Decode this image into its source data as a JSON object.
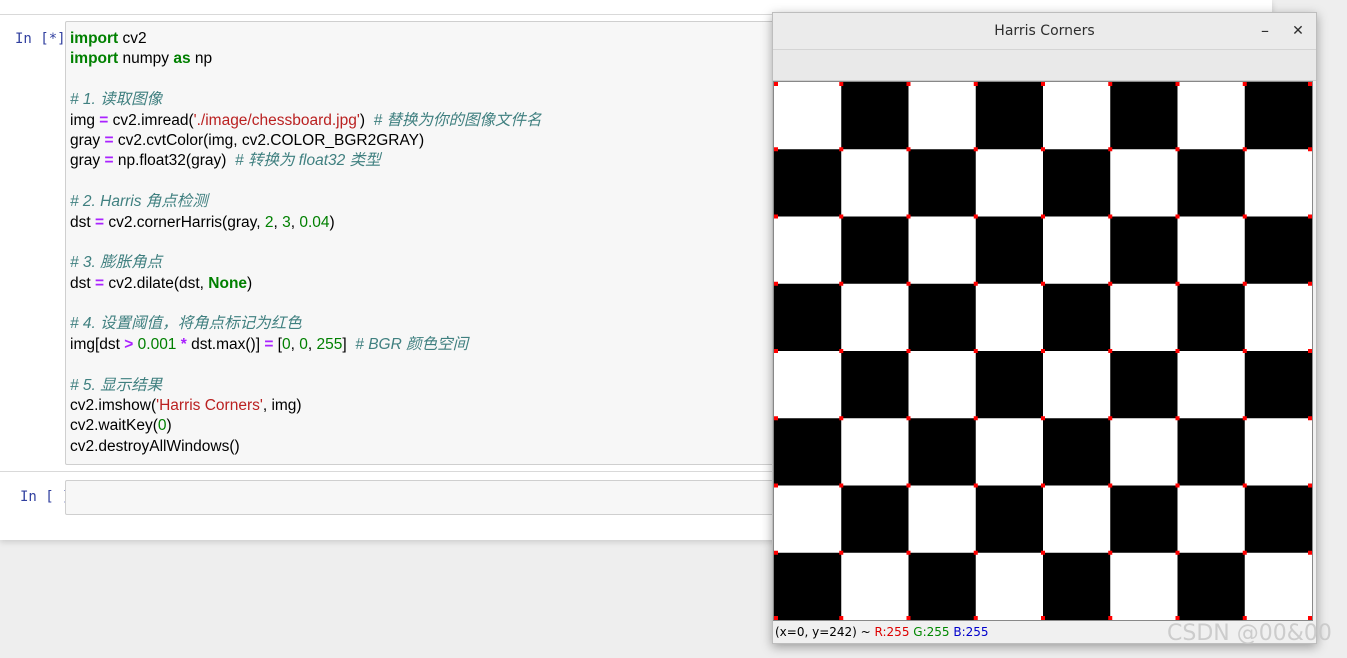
{
  "notebook": {
    "cell1_prompt": "In [*]:",
    "cell2_prompt": "In [ ]:",
    "code_lines": [
      [
        {
          "t": "import",
          "c": "kw"
        },
        {
          "t": " cv2",
          "c": ""
        }
      ],
      [
        {
          "t": "import",
          "c": "kw"
        },
        {
          "t": " numpy ",
          "c": ""
        },
        {
          "t": "as",
          "c": "kw"
        },
        {
          "t": " np",
          "c": ""
        }
      ],
      [],
      [
        {
          "t": "# 1. 读取图像",
          "c": "cmt"
        }
      ],
      [
        {
          "t": "img ",
          "c": ""
        },
        {
          "t": "=",
          "c": "op"
        },
        {
          "t": " cv2.imread(",
          "c": ""
        },
        {
          "t": "'./image/chessboard.jpg'",
          "c": "str"
        },
        {
          "t": ")  ",
          "c": ""
        },
        {
          "t": "# 替换为你的图像文件名",
          "c": "cmt"
        }
      ],
      [
        {
          "t": "gray ",
          "c": ""
        },
        {
          "t": "=",
          "c": "op"
        },
        {
          "t": " cv2.cvtColor(img, cv2.COLOR_BGR2GRAY)",
          "c": ""
        }
      ],
      [
        {
          "t": "gray ",
          "c": ""
        },
        {
          "t": "=",
          "c": "op"
        },
        {
          "t": " np.float32(gray)  ",
          "c": ""
        },
        {
          "t": "# 转换为 float32 类型",
          "c": "cmt"
        }
      ],
      [],
      [
        {
          "t": "# 2. Harris 角点检测",
          "c": "cmt"
        }
      ],
      [
        {
          "t": "dst ",
          "c": ""
        },
        {
          "t": "=",
          "c": "op"
        },
        {
          "t": " cv2.cornerHarris(gray, ",
          "c": ""
        },
        {
          "t": "2",
          "c": "num"
        },
        {
          "t": ", ",
          "c": ""
        },
        {
          "t": "3",
          "c": "num"
        },
        {
          "t": ", ",
          "c": ""
        },
        {
          "t": "0.04",
          "c": "num"
        },
        {
          "t": ")",
          "c": ""
        }
      ],
      [],
      [
        {
          "t": "# 3. 膨胀角点",
          "c": "cmt"
        }
      ],
      [
        {
          "t": "dst ",
          "c": ""
        },
        {
          "t": "=",
          "c": "op"
        },
        {
          "t": " cv2.dilate(dst, ",
          "c": ""
        },
        {
          "t": "None",
          "c": "kw"
        },
        {
          "t": ")",
          "c": ""
        }
      ],
      [],
      [
        {
          "t": "# 4. 设置阈值，将角点标记为红色",
          "c": "cmt"
        }
      ],
      [
        {
          "t": "img[dst ",
          "c": ""
        },
        {
          "t": ">",
          "c": "op"
        },
        {
          "t": " ",
          "c": ""
        },
        {
          "t": "0.001",
          "c": "num"
        },
        {
          "t": " ",
          "c": ""
        },
        {
          "t": "*",
          "c": "op"
        },
        {
          "t": " dst.max()] ",
          "c": ""
        },
        {
          "t": "=",
          "c": "op"
        },
        {
          "t": " [",
          "c": ""
        },
        {
          "t": "0",
          "c": "num"
        },
        {
          "t": ", ",
          "c": ""
        },
        {
          "t": "0",
          "c": "num"
        },
        {
          "t": ", ",
          "c": ""
        },
        {
          "t": "255",
          "c": "num"
        },
        {
          "t": "]  ",
          "c": ""
        },
        {
          "t": "# BGR 颜色空间",
          "c": "cmt"
        }
      ],
      [],
      [
        {
          "t": "# 5. 显示结果",
          "c": "cmt"
        }
      ],
      [
        {
          "t": "cv2.imshow(",
          "c": ""
        },
        {
          "t": "'Harris Corners'",
          "c": "str"
        },
        {
          "t": ", img)",
          "c": ""
        }
      ],
      [
        {
          "t": "cv2.waitKey(",
          "c": ""
        },
        {
          "t": "0",
          "c": "num"
        },
        {
          "t": ")",
          "c": ""
        }
      ],
      [
        {
          "t": "cv2.destroyAllWindows()",
          "c": ""
        }
      ]
    ]
  },
  "cv_window": {
    "title": "Harris Corners",
    "minimize_glyph": "–",
    "close_glyph": "✕",
    "status": {
      "coords": "(x=0, y=242) ~ ",
      "r": "R:255",
      "g": "G:255",
      "b": "B:255"
    },
    "board": {
      "rows": 8,
      "cols": 8,
      "first_square": "white",
      "dark_color": "#000000",
      "light_color": "#ffffff",
      "corner_marker_color": "#ff0000"
    }
  },
  "colors": {
    "status_r": "#dd0000",
    "status_g": "#008800",
    "status_b": "#0000cc",
    "prompt": "#303f9f"
  },
  "watermark": "CSDN @00&00"
}
